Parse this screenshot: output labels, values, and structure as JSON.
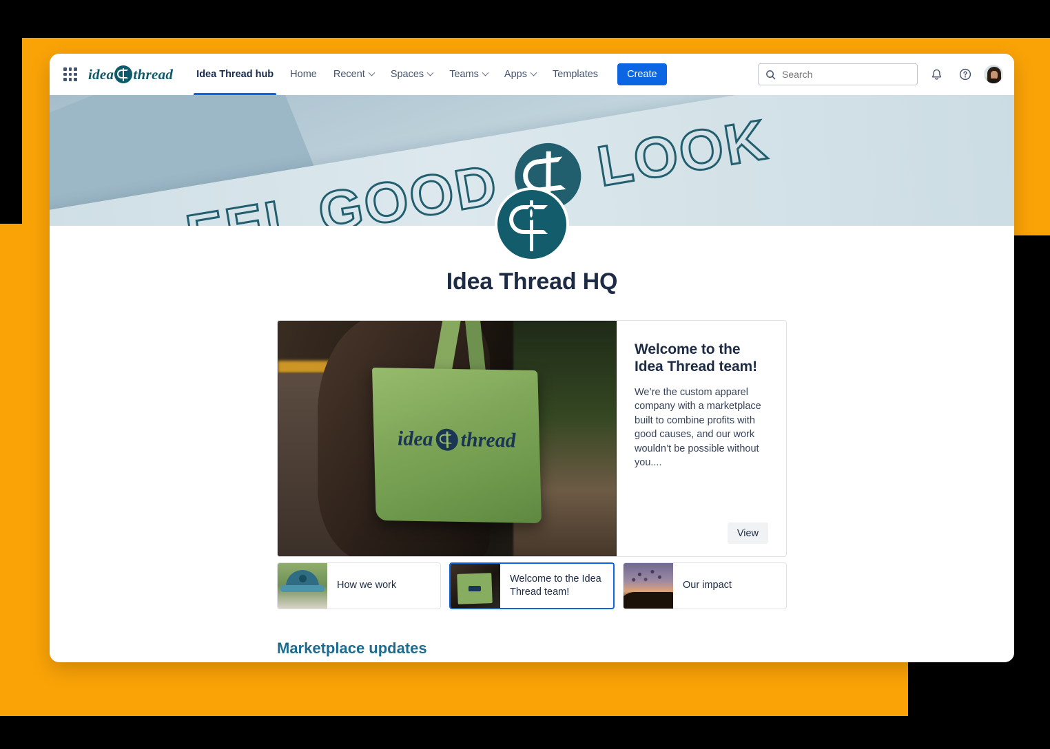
{
  "theme": {
    "accent_orange": "#FAA307",
    "brand_teal": "#125C6B",
    "primary_blue": "#0C66E4",
    "heading_navy": "#1D2B45",
    "section_heading_teal": "#1D6B8F"
  },
  "topnav": {
    "app_switcher_icon": "grid-apps-icon",
    "brand": {
      "text_left": "idea",
      "text_right": "thread",
      "mark_icon": "needle-thread-logo-icon"
    },
    "items": [
      {
        "label": "Idea Thread hub",
        "active": true,
        "has_caret": false
      },
      {
        "label": "Home",
        "active": false,
        "has_caret": false
      },
      {
        "label": "Recent",
        "active": false,
        "has_caret": true
      },
      {
        "label": "Spaces",
        "active": false,
        "has_caret": true
      },
      {
        "label": "Teams",
        "active": false,
        "has_caret": true
      },
      {
        "label": "Apps",
        "active": false,
        "has_caret": true
      },
      {
        "label": "Templates",
        "active": false,
        "has_caret": false
      }
    ],
    "create_label": "Create",
    "search": {
      "placeholder": "Search",
      "value": "",
      "icon": "search-icon"
    },
    "notifications_icon": "bell-icon",
    "help_icon": "question-circle-icon",
    "avatar_icon": "user-avatar"
  },
  "banner": {
    "word_1": "EEL",
    "word_2": "GOOD",
    "logo_icon": "needle-thread-logo-icon",
    "word_3": "LOOK"
  },
  "page": {
    "logo_icon": "needle-thread-logo-icon",
    "title": "Idea Thread HQ"
  },
  "hero": {
    "image_alt": "person-carrying-green-idea-thread-tote-bag",
    "bag_text_left": "idea",
    "bag_text_right": "thread",
    "heading_line1": "Welcome to the",
    "heading_line2": "Idea Thread team!",
    "body": "We’re the custom apparel company with a marketplace built to combine profits with good causes, and our work wouldn’t be possible without you....",
    "view_label": "View"
  },
  "thumbnails": [
    {
      "label": "How we work",
      "selected": false,
      "image_alt": "person-wearing-blue-cap"
    },
    {
      "label": "Welcome to the Idea Thread team!",
      "selected": true,
      "image_alt": "green-tote-bag-thumbnail"
    },
    {
      "label": "Our impact",
      "selected": false,
      "image_alt": "starling-murmuration-at-sunset"
    }
  ],
  "sections": {
    "marketplace_updates_heading": "Marketplace updates"
  }
}
